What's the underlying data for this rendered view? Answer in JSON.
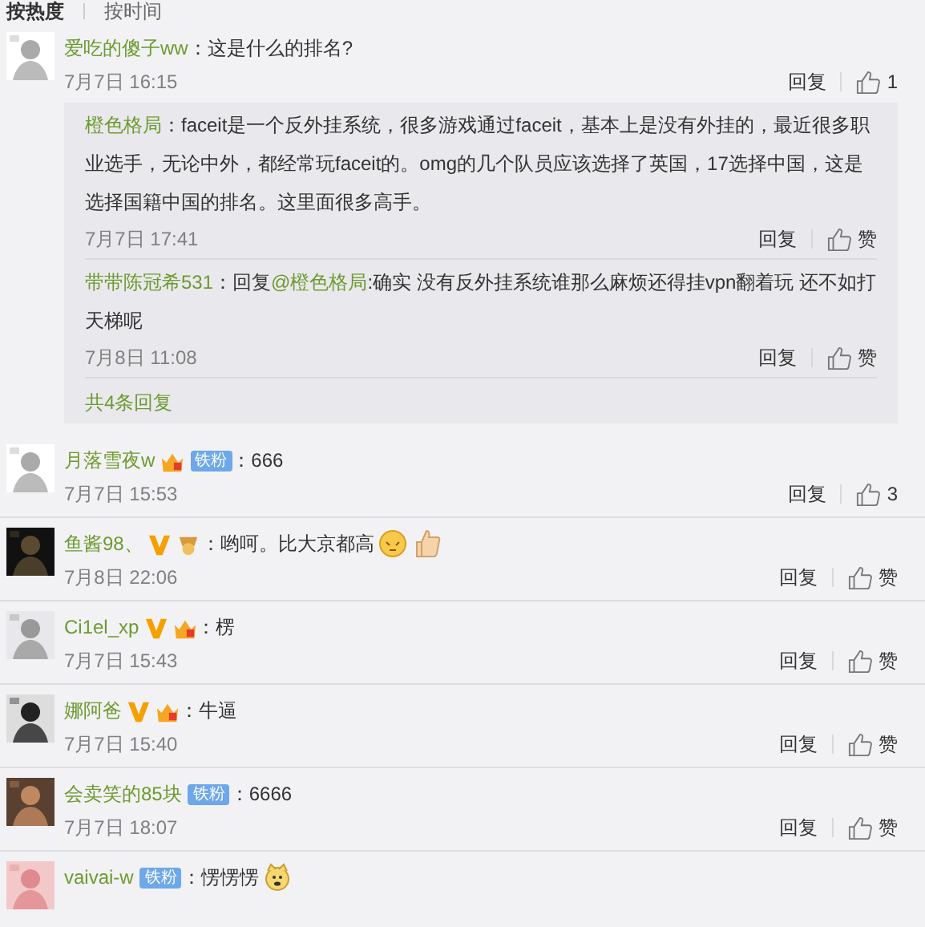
{
  "sort_tabs": [
    {
      "label": "按热度",
      "selected": true
    },
    {
      "label": "按时间",
      "selected": false
    }
  ],
  "comments": [
    {
      "name": "爱吃的傻子ww",
      "text": "：这是什么的排名?",
      "time": "7月7日 16:15",
      "reply": "回复",
      "like": "1",
      "replies": [
        {
          "name": "橙色格局",
          "text": "：faceit是一个反外挂系统，很多游戏通过faceit，基本上是没有外挂的，最近很多职业选手，无论中外，都经常玩faceit的。omg的几个队员应该选择了英国，17选择中国，这是选择国籍中国的排名。这里面很多高手。",
          "time": "7月7日 17:41",
          "reply": "回复",
          "like": "赞"
        },
        {
          "name": "带带陈冠希531",
          "reply_prefix": "：回复",
          "mention": "@橙色格局",
          "text": ":确实 没有反外挂系统谁那么麻烦还得挂vpn翻着玩 还不如打天梯呢",
          "time": "7月8日 11:08",
          "reply": "回复",
          "like": "赞"
        }
      ],
      "more": "共4条回复"
    },
    {
      "name": "月落雪夜w",
      "badges": [
        {
          "kind": "crown"
        },
        {
          "kind": "fan",
          "label": "铁粉"
        }
      ],
      "text": "：666",
      "time": "7月7日 15:53",
      "reply": "回复",
      "like": "3"
    },
    {
      "name": "鱼酱98、",
      "badges": [
        {
          "kind": "verified"
        },
        {
          "kind": "gold"
        }
      ],
      "text": "：哟呵。比大京都高",
      "emojis": [
        {
          "kind": "face"
        },
        {
          "kind": "thumb"
        }
      ],
      "time": "7月8日 22:06",
      "reply": "回复",
      "like": "赞"
    },
    {
      "name": "Ci1el_xp",
      "badges": [
        {
          "kind": "verified"
        },
        {
          "kind": "crown"
        }
      ],
      "text": "：楞",
      "time": "7月7日 15:43",
      "reply": "回复",
      "like": "赞"
    },
    {
      "name": "娜阿爸",
      "badges": [
        {
          "kind": "verified"
        },
        {
          "kind": "crown"
        }
      ],
      "text": "：牛逼",
      "time": "7月7日 15:40",
      "reply": "回复",
      "like": "赞"
    },
    {
      "name": "会卖笑的85块",
      "badges": [
        {
          "kind": "fan",
          "label": "铁粉"
        }
      ],
      "text": "：6666",
      "time": "7月7日 18:07",
      "reply": "回复",
      "like": "赞"
    },
    {
      "name": "vaivai-w",
      "badges": [
        {
          "kind": "fan",
          "label": "铁粉"
        }
      ],
      "text": "：愣愣愣",
      "emojis": [
        {
          "kind": "dog"
        }
      ]
    }
  ]
}
